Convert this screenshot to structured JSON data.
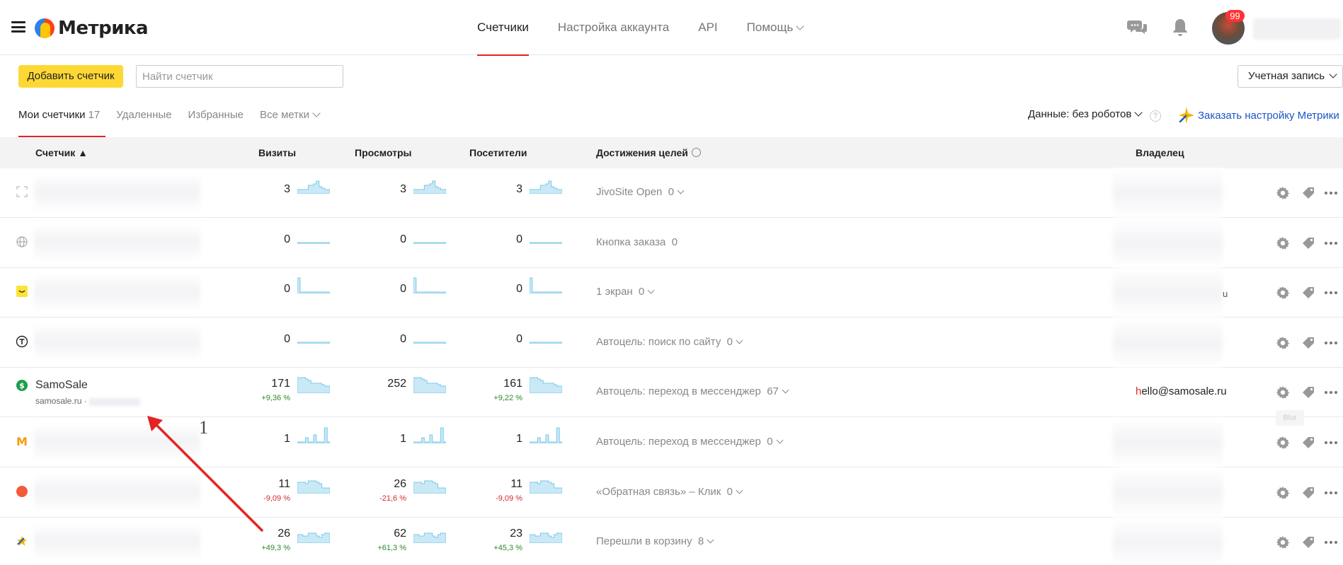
{
  "header": {
    "logo": "Метрика",
    "tabs": [
      {
        "label": "Счетчики",
        "active": true
      },
      {
        "label": "Настройка аккаунта",
        "active": false
      },
      {
        "label": "API",
        "active": false
      },
      {
        "label": "Помощь",
        "active": false,
        "dropdown": true
      }
    ],
    "notification_badge": "99"
  },
  "toolbar": {
    "add_counter": "Добавить счетчик",
    "search_placeholder": "Найти счетчик",
    "account_select": "Учетная запись"
  },
  "subtabs": {
    "mine": "Мои счетчики",
    "mine_count": "17",
    "deleted": "Удаленные",
    "favorites": "Избранные",
    "all_tags": "Все метки"
  },
  "data_filter": "Данные: без роботов",
  "help_mark": "?",
  "order_setup": "Заказать настройку Метрики",
  "table": {
    "headers": {
      "counter": "Счетчик ▲",
      "visits": "Визиты",
      "views": "Просмотры",
      "visitors": "Посетители",
      "goals": "Достижения целей",
      "owner": "Владелец"
    },
    "rows": [
      {
        "icon": "fullscreen-icon",
        "visits": "3",
        "views": "3",
        "visitors": "3",
        "goal": "JivoSite Open",
        "goal_count": "0",
        "goal_dropdown": true
      },
      {
        "icon": "globe-icon",
        "visits": "0",
        "views": "0",
        "visitors": "0",
        "goal": "Кнопка заказа",
        "goal_count": "0",
        "goal_dropdown": false
      },
      {
        "icon": "yellow-square-icon",
        "visits": "0",
        "views": "0",
        "visitors": "0",
        "goal": "1 экран",
        "goal_count": "0",
        "goal_dropdown": true
      },
      {
        "icon": "circle-t-icon",
        "visits": "0",
        "views": "0",
        "visitors": "0",
        "goal": "Автоцель: поиск по сайту",
        "goal_count": "0",
        "goal_dropdown": true
      },
      {
        "icon": "samosale-icon",
        "name": "SamoSale",
        "domain": "samosale.ru · ",
        "visits": "171",
        "visits_delta": "+9,36 %",
        "views": "252",
        "visitors": "161",
        "visitors_delta": "+9,22 %",
        "goal": "Автоцель: переход в мессенджер",
        "goal_count": "67",
        "goal_dropdown": true,
        "owner_first": "h",
        "owner_rest": "ello@samosale.ru"
      },
      {
        "icon": "m-letter-icon",
        "visits": "1",
        "views": "1",
        "visitors": "1",
        "goal": "Автоцель: переход в мессенджер",
        "goal_count": "0",
        "goal_dropdown": true
      },
      {
        "icon": "red-dot-icon",
        "visits": "11",
        "visits_delta": "-9,09 %",
        "views": "26",
        "views_delta": "-21,6 %",
        "visitors": "11",
        "visitors_delta": "-9,09 %",
        "goal": "«Обратная связь» – Клик",
        "goal_count": "0",
        "goal_dropdown": true
      },
      {
        "icon": "star-icon",
        "visits": "26",
        "visits_delta": "+49,3 %",
        "views": "62",
        "views_delta": "+61,3 %",
        "visitors": "23",
        "visitors_delta": "+45,3 %",
        "goal": "Перешли в корзину",
        "goal_count": "8",
        "goal_dropdown": true
      }
    ],
    "tooltip": "Blur",
    "stray_char": "u"
  },
  "annotation": {
    "number": "1",
    "arrow_color": "#e52222"
  },
  "colors": {
    "accent_red": "#e52222",
    "add_button": "#fdd835",
    "link_blue": "#1a55c8",
    "spark_fill": "#c9e9f6",
    "spark_line": "#7cc9e8",
    "up": "#2b8a2b",
    "down": "#d42b2b"
  }
}
